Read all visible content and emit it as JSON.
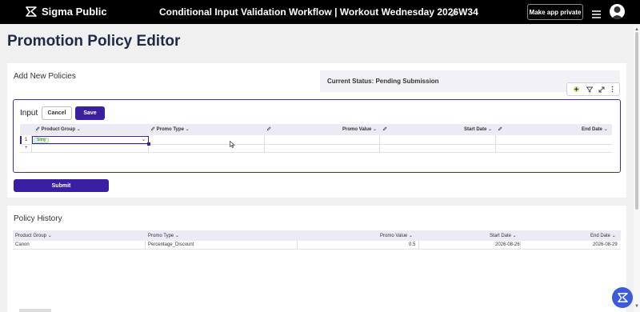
{
  "app": {
    "brand": "Sigma Public",
    "title": "Conditional Input Validation Workflow | Workout Wednesday 2026W34",
    "make_private_label": "Make app private"
  },
  "page": {
    "title": "Promotion Policy Editor"
  },
  "add_section": {
    "title": "Add New Policies",
    "status_text": "Current Status: Pending Submission",
    "input_label": "Input",
    "cancel_label": "Cancel",
    "save_label": "Save",
    "submit_label": "Submit",
    "columns": [
      "Product Group",
      "Promo Type",
      "Promo Value",
      "Start Date",
      "End Date"
    ],
    "rows": [
      {
        "num": "1",
        "product_group": "Sony",
        "promo_type": "",
        "promo_value": "",
        "start_date": "",
        "end_date": ""
      }
    ],
    "add_row_symbol": "+"
  },
  "history": {
    "title": "Policy History",
    "columns": [
      "Product Group",
      "Promo Type",
      "Promo Value",
      "Start Date",
      "End Date"
    ],
    "rows": [
      {
        "product_group": "Canon",
        "promo_type": "Percentage_Discount",
        "promo_value": "0.5",
        "start_date": "2026-08-26",
        "end_date": "2026-08-29"
      }
    ]
  },
  "colors": {
    "accent": "#3b1fa3",
    "topbar": "#000000",
    "help_button": "#3b5bdb"
  }
}
